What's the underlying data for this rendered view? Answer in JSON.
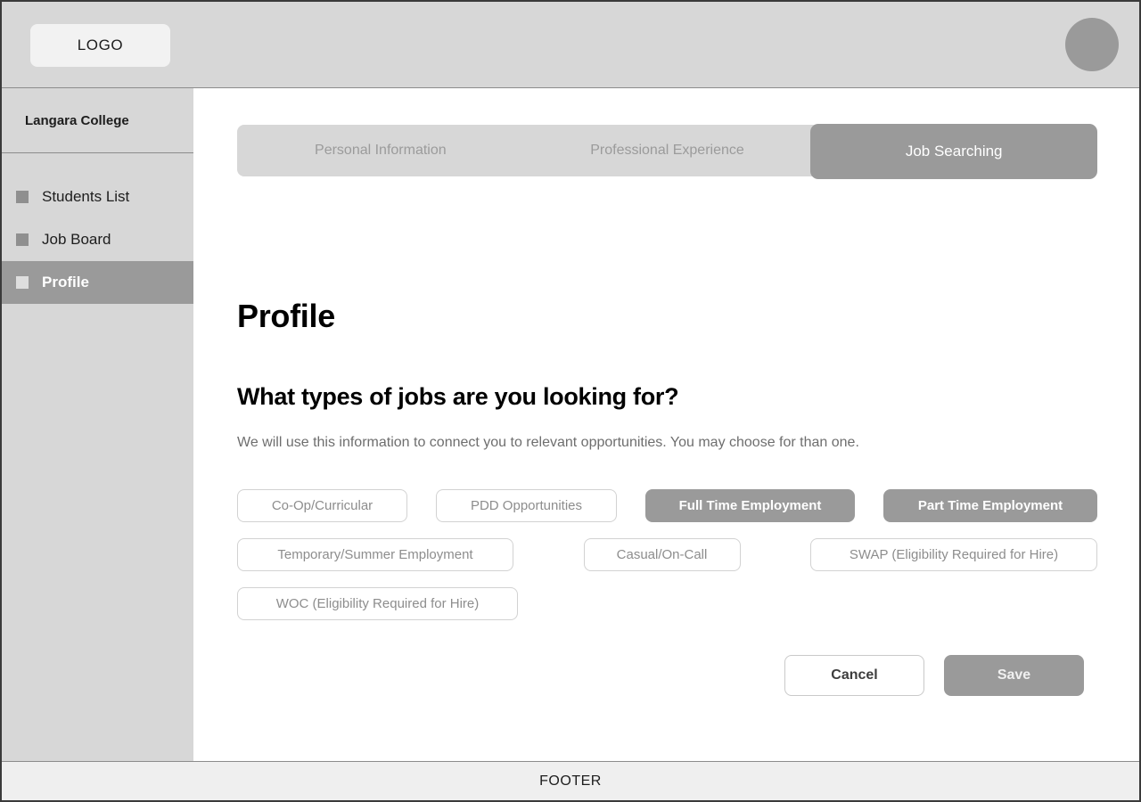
{
  "header": {
    "logo_label": "LOGO",
    "avatar_icon": "user-avatar-circle"
  },
  "sidebar": {
    "org_name": "Langara College",
    "items": [
      {
        "label": "Students List",
        "icon": "square-icon",
        "active": false
      },
      {
        "label": "Job Board",
        "icon": "square-icon",
        "active": false
      },
      {
        "label": "Profile",
        "icon": "square-icon",
        "active": true
      }
    ]
  },
  "main": {
    "tabs": [
      {
        "label": "Personal Information",
        "active": false
      },
      {
        "label": "Professional Experience",
        "active": false
      },
      {
        "label": "Job Searching",
        "active": true
      }
    ],
    "page_title": "Profile",
    "section": {
      "title": "What types of jobs are you looking for?",
      "subtitle": "We will use this information to connect you to relevant opportunities. You may choose for than one."
    },
    "chip_rows": [
      [
        {
          "label": "Co-Op/Curricular",
          "selected": false
        },
        {
          "label": "PDD Opportunities",
          "selected": false
        },
        {
          "label": "Full Time Employment",
          "selected": true
        },
        {
          "label": "Part Time Employment",
          "selected": true
        }
      ],
      [
        {
          "label": "Temporary/Summer Employment",
          "selected": false
        },
        {
          "label": "Casual/On-Call",
          "selected": false
        },
        {
          "label": "SWAP (Eligibility Required for Hire)",
          "selected": false
        }
      ],
      [
        {
          "label": "WOC (Eligibility Required for Hire)",
          "selected": false
        }
      ]
    ],
    "actions": {
      "cancel_label": "Cancel",
      "save_label": "Save"
    }
  },
  "footer": {
    "label": "FOOTER"
  },
  "colors": {
    "chrome": "#d7d7d7",
    "accent": "#9a9a9a",
    "footer": "#efefef",
    "text": "#1d1d1d",
    "muted": "#8d8d8d"
  }
}
